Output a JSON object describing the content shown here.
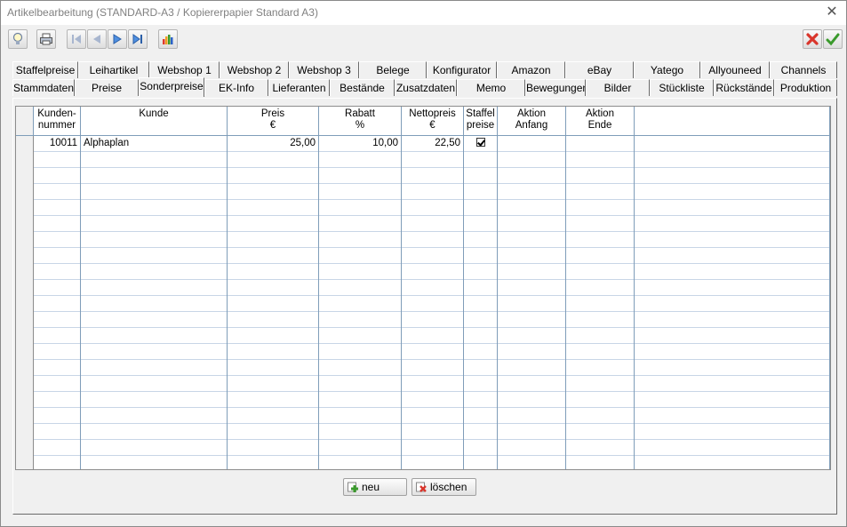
{
  "window": {
    "title": "Artikelbearbeitung (STANDARD-A3 / Kopiererpapier Standard A3)",
    "close_glyph": "✕"
  },
  "toolbar": {
    "icons": [
      "lightbulb-icon",
      "printer-icon",
      "first-record-icon",
      "previous-record-icon",
      "next-record-icon",
      "last-record-icon",
      "statistics-icon",
      "cancel-icon",
      "confirm-icon"
    ]
  },
  "tabs": {
    "row1": [
      "Staffelpreise",
      "Leihartikel",
      "Webshop 1",
      "Webshop 2",
      "Webshop 3",
      "Belege",
      "Konfigurator",
      "Amazon",
      "eBay",
      "Yatego",
      "Allyouneed",
      "Channels"
    ],
    "row2": [
      "Stammdaten",
      "Preise",
      "Sonderpreise",
      "EK-Info",
      "Lieferanten",
      "Bestände",
      "Zusatzdaten",
      "Memo",
      "Bewegungen",
      "Bilder",
      "Stückliste",
      "Rückstände",
      "Produktion"
    ],
    "active": "Sonderpreise"
  },
  "grid": {
    "columns": [
      {
        "l1": "",
        "l2": ""
      },
      {
        "l1": "Kunden-",
        "l2": "nummer"
      },
      {
        "l1": "Kunde",
        "l2": ""
      },
      {
        "l1": "Preis",
        "l2": "€"
      },
      {
        "l1": "Rabatt",
        "l2": "%"
      },
      {
        "l1": "Nettopreis",
        "l2": "€"
      },
      {
        "l1": "Staffel",
        "l2": "preise"
      },
      {
        "l1": "Aktion",
        "l2": "Anfang"
      },
      {
        "l1": "Aktion",
        "l2": "Ende"
      },
      {
        "l1": "",
        "l2": ""
      }
    ],
    "rows": [
      {
        "kundennummer": "10011",
        "kunde": "Alphaplan",
        "preis": "25,00",
        "rabatt": "10,00",
        "nettopreis": "22,50",
        "staffelpreise": true,
        "aktion_anfang": "",
        "aktion_ende": ""
      }
    ],
    "empty_rows": 20
  },
  "buttons": {
    "new_label": "neu",
    "delete_label": "löschen"
  },
  "colors": {
    "grid_line": "#7f9db9",
    "cancel_red": "#d9352b",
    "confirm_green": "#3a9a2c"
  }
}
